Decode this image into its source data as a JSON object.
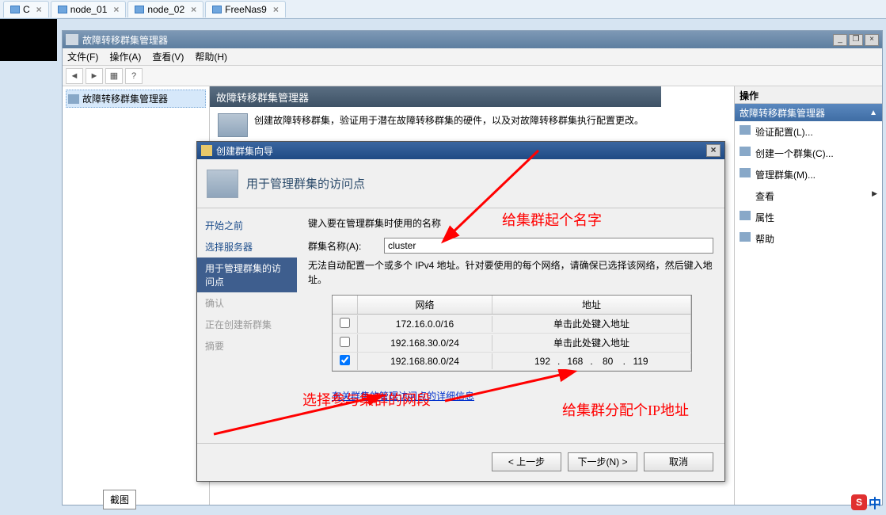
{
  "tabs": [
    {
      "label": "C"
    },
    {
      "label": "node_01"
    },
    {
      "label": "node_02"
    },
    {
      "label": "FreeNas9"
    }
  ],
  "mmc": {
    "title": "故障转移群集管理器",
    "menu": {
      "file": "文件(F)",
      "action": "操作(A)",
      "view": "查看(V)",
      "help": "帮助(H)"
    },
    "tree_root": "故障转移群集管理器",
    "center_title": "故障转移群集管理器",
    "center_desc": "创建故障转移群集，验证用于潜在故障转移群集的硬件，以及对故障转移群集执行配置更改。"
  },
  "actions": {
    "header": "操作",
    "sub": "故障转移群集管理器",
    "items": [
      {
        "label": "验证配置(L)..."
      },
      {
        "label": "创建一个群集(C)..."
      },
      {
        "label": "管理群集(M)..."
      },
      {
        "label": "查看",
        "arrow": true
      },
      {
        "label": "属性"
      },
      {
        "label": "帮助"
      }
    ]
  },
  "wizard": {
    "title": "创建群集向导",
    "header": "用于管理群集的访问点",
    "steps": {
      "s1": "开始之前",
      "s2": "选择服务器",
      "s3": "用于管理群集的访问点",
      "s4": "确认",
      "s5": "正在创建新群集",
      "s6": "摘要"
    },
    "instr": "键入要在管理群集时使用的名称",
    "name_label": "群集名称(A):",
    "name_value": "cluster",
    "ip_note": "无法自动配置一个或多个 IPv4 地址。针对要使用的每个网络，请确保已选择该网络，然后键入地址。",
    "table": {
      "h_net": "网络",
      "h_addr": "地址",
      "rows": [
        {
          "checked": false,
          "network": "172.16.0.0/16",
          "addr": "单击此处键入地址"
        },
        {
          "checked": false,
          "network": "192.168.30.0/24",
          "addr": "单击此处键入地址"
        },
        {
          "checked": true,
          "network": "192.168.80.0/24",
          "addr_parts": [
            "192",
            "168",
            "80",
            "119"
          ]
        }
      ]
    },
    "link": "有关群集的管理访问点的详细信息",
    "buttons": {
      "prev": "< 上一步",
      "next": "下一步(N) >",
      "cancel": "取消"
    }
  },
  "annotations": {
    "a1": "给集群起个名字",
    "a2": "选择参与集群的网段",
    "a3": "给集群分配个IP地址"
  },
  "caption": "截图",
  "ime": {
    "s": "S",
    "zh": "中"
  }
}
